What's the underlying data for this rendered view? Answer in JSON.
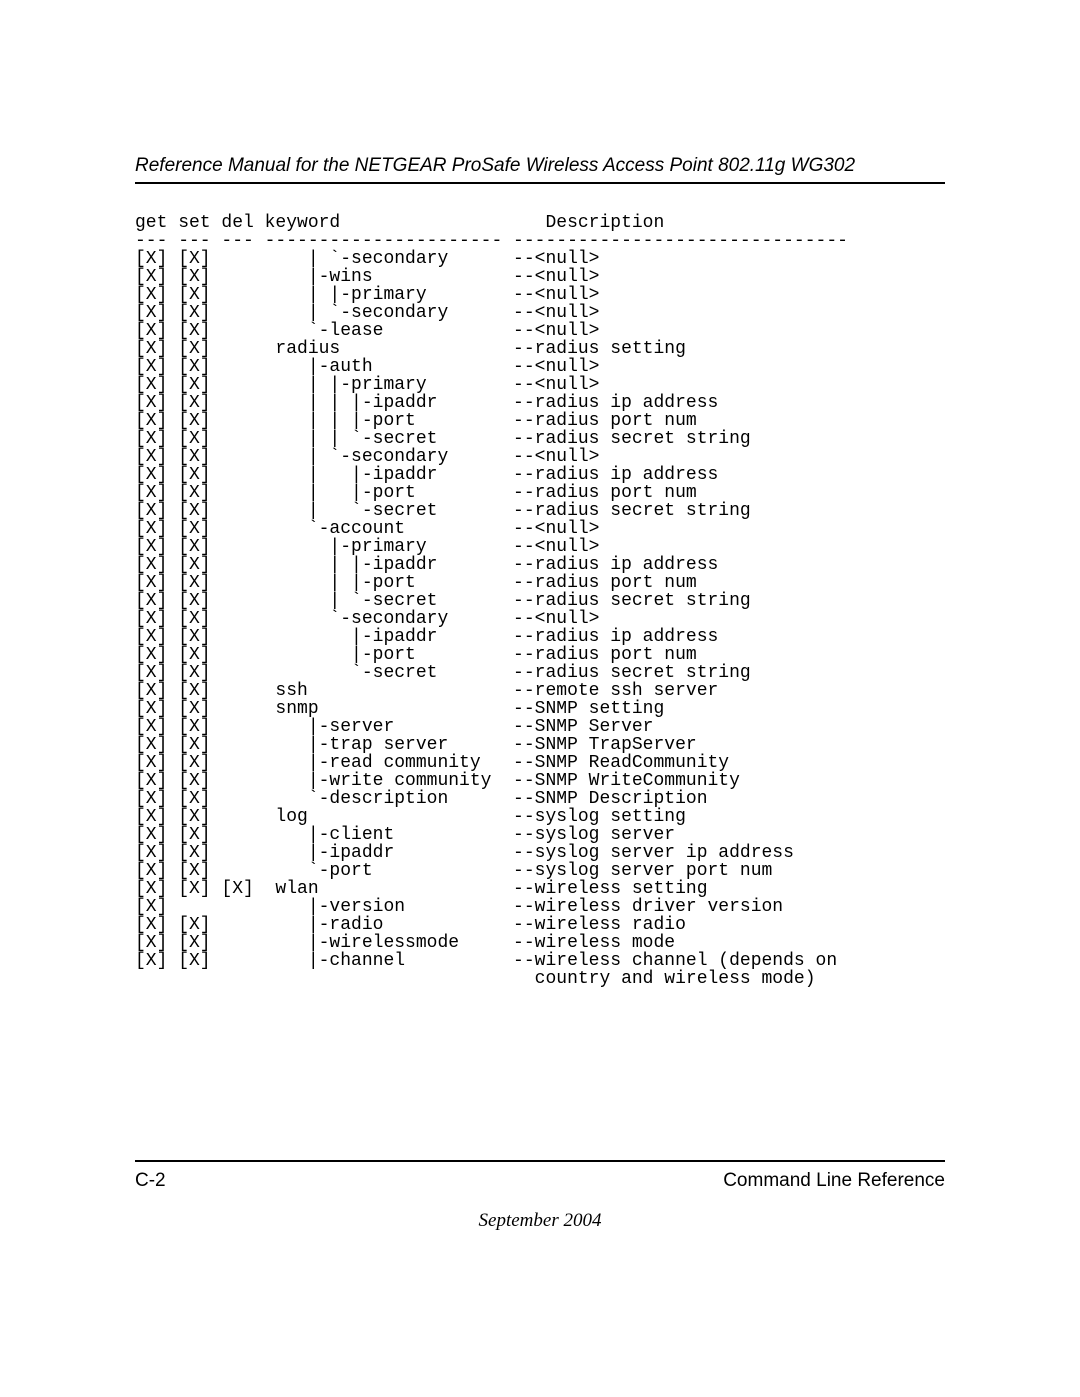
{
  "doc": {
    "header_title": "Reference Manual for the NETGEAR ProSafe Wireless Access Point 802.11g WG302",
    "page_number": "C-2",
    "section": "Command Line Reference",
    "date": "September 2004"
  },
  "columns": {
    "get": "get",
    "set": "set",
    "del": "del",
    "keyword": "keyword",
    "description": "Description",
    "sep_get": "---",
    "sep_set": "---",
    "sep_del": "---",
    "sep_keyword": "----------------------",
    "sep_desc": "-------------------------------"
  },
  "rows": [
    {
      "get": "[X]",
      "set": "[X]",
      "del": "   ",
      "kw": "    | `-secondary      ",
      "desc": "--<null>"
    },
    {
      "get": "[X]",
      "set": "[X]",
      "del": "   ",
      "kw": "    |-wins             ",
      "desc": "--<null>"
    },
    {
      "get": "[X]",
      "set": "[X]",
      "del": "   ",
      "kw": "    | |-primary        ",
      "desc": "--<null>"
    },
    {
      "get": "[X]",
      "set": "[X]",
      "del": "   ",
      "kw": "    | `-secondary      ",
      "desc": "--<null>"
    },
    {
      "get": "[X]",
      "set": "[X]",
      "del": "   ",
      "kw": "    `-lease            ",
      "desc": "--<null>"
    },
    {
      "get": "[X]",
      "set": "[X]",
      "del": "   ",
      "kw": " radius               ",
      "desc": "--radius setting"
    },
    {
      "get": "[X]",
      "set": "[X]",
      "del": "   ",
      "kw": "    |-auth             ",
      "desc": "--<null>"
    },
    {
      "get": "[X]",
      "set": "[X]",
      "del": "   ",
      "kw": "    | |-primary        ",
      "desc": "--<null>"
    },
    {
      "get": "[X]",
      "set": "[X]",
      "del": "   ",
      "kw": "    | | |-ipaddr       ",
      "desc": "--radius ip address"
    },
    {
      "get": "[X]",
      "set": "[X]",
      "del": "   ",
      "kw": "    | | |-port         ",
      "desc": "--radius port num"
    },
    {
      "get": "[X]",
      "set": "[X]",
      "del": "   ",
      "kw": "    | | `-secret       ",
      "desc": "--radius secret string"
    },
    {
      "get": "[X]",
      "set": "[X]",
      "del": "   ",
      "kw": "    | `-secondary      ",
      "desc": "--<null>"
    },
    {
      "get": "[X]",
      "set": "[X]",
      "del": "   ",
      "kw": "    |   |-ipaddr       ",
      "desc": "--radius ip address"
    },
    {
      "get": "[X]",
      "set": "[X]",
      "del": "   ",
      "kw": "    |   |-port         ",
      "desc": "--radius port num"
    },
    {
      "get": "[X]",
      "set": "[X]",
      "del": "   ",
      "kw": "    |   `-secret       ",
      "desc": "--radius secret string"
    },
    {
      "get": "[X]",
      "set": "[X]",
      "del": "   ",
      "kw": "    `-account          ",
      "desc": "--<null>"
    },
    {
      "get": "[X]",
      "set": "[X]",
      "del": "   ",
      "kw": "      |-primary        ",
      "desc": "--<null>"
    },
    {
      "get": "[X]",
      "set": "[X]",
      "del": "   ",
      "kw": "      | |-ipaddr       ",
      "desc": "--radius ip address"
    },
    {
      "get": "[X]",
      "set": "[X]",
      "del": "   ",
      "kw": "      | |-port         ",
      "desc": "--radius port num"
    },
    {
      "get": "[X]",
      "set": "[X]",
      "del": "   ",
      "kw": "      | `-secret       ",
      "desc": "--radius secret string"
    },
    {
      "get": "[X]",
      "set": "[X]",
      "del": "   ",
      "kw": "      `-secondary      ",
      "desc": "--<null>"
    },
    {
      "get": "[X]",
      "set": "[X]",
      "del": "   ",
      "kw": "        |-ipaddr       ",
      "desc": "--radius ip address"
    },
    {
      "get": "[X]",
      "set": "[X]",
      "del": "   ",
      "kw": "        |-port         ",
      "desc": "--radius port num"
    },
    {
      "get": "[X]",
      "set": "[X]",
      "del": "   ",
      "kw": "        `-secret       ",
      "desc": "--radius secret string"
    },
    {
      "get": "[X]",
      "set": "[X]",
      "del": "   ",
      "kw": " ssh                  ",
      "desc": "--remote ssh server"
    },
    {
      "get": "[X]",
      "set": "[X]",
      "del": "   ",
      "kw": " snmp                 ",
      "desc": "--SNMP setting"
    },
    {
      "get": "[X]",
      "set": "[X]",
      "del": "   ",
      "kw": "    |-server           ",
      "desc": "--SNMP Server"
    },
    {
      "get": "[X]",
      "set": "[X]",
      "del": "   ",
      "kw": "    |-trap server      ",
      "desc": "--SNMP TrapServer"
    },
    {
      "get": "[X]",
      "set": "[X]",
      "del": "   ",
      "kw": "    |-read community   ",
      "desc": "--SNMP ReadCommunity"
    },
    {
      "get": "[X]",
      "set": "[X]",
      "del": "   ",
      "kw": "    |-write community  ",
      "desc": "--SNMP WriteCommunity"
    },
    {
      "get": "[X]",
      "set": "[X]",
      "del": "   ",
      "kw": "    `-description      ",
      "desc": "--SNMP Description"
    },
    {
      "get": "[X]",
      "set": "[X]",
      "del": "   ",
      "kw": " log                  ",
      "desc": "--syslog setting"
    },
    {
      "get": "[X]",
      "set": "[X]",
      "del": "   ",
      "kw": "    |-client           ",
      "desc": "--syslog server"
    },
    {
      "get": "[X]",
      "set": "[X]",
      "del": "   ",
      "kw": "    |-ipaddr           ",
      "desc": "--syslog server ip address"
    },
    {
      "get": "[X]",
      "set": "[X]",
      "del": "   ",
      "kw": "    `-port             ",
      "desc": "--syslog server port num"
    },
    {
      "get": "[X]",
      "set": "[X]",
      "del": "[X]",
      "kw": " wlan                 ",
      "desc": "--wireless setting"
    },
    {
      "get": "[X]",
      "set": "   ",
      "del": "   ",
      "kw": "    |-version          ",
      "desc": "--wireless driver version"
    },
    {
      "get": "[X]",
      "set": "[X]",
      "del": "   ",
      "kw": "    |-radio            ",
      "desc": "--wireless radio"
    },
    {
      "get": "[X]",
      "set": "[X]",
      "del": "   ",
      "kw": "    |-wirelessmode     ",
      "desc": "--wireless mode"
    },
    {
      "get": "[X]",
      "set": "[X]",
      "del": "   ",
      "kw": "    |-channel          ",
      "desc": "--wireless channel (depends on"
    },
    {
      "get": "   ",
      "set": "   ",
      "del": "   ",
      "kw": "                       ",
      "desc": "  country and wireless mode)"
    }
  ]
}
